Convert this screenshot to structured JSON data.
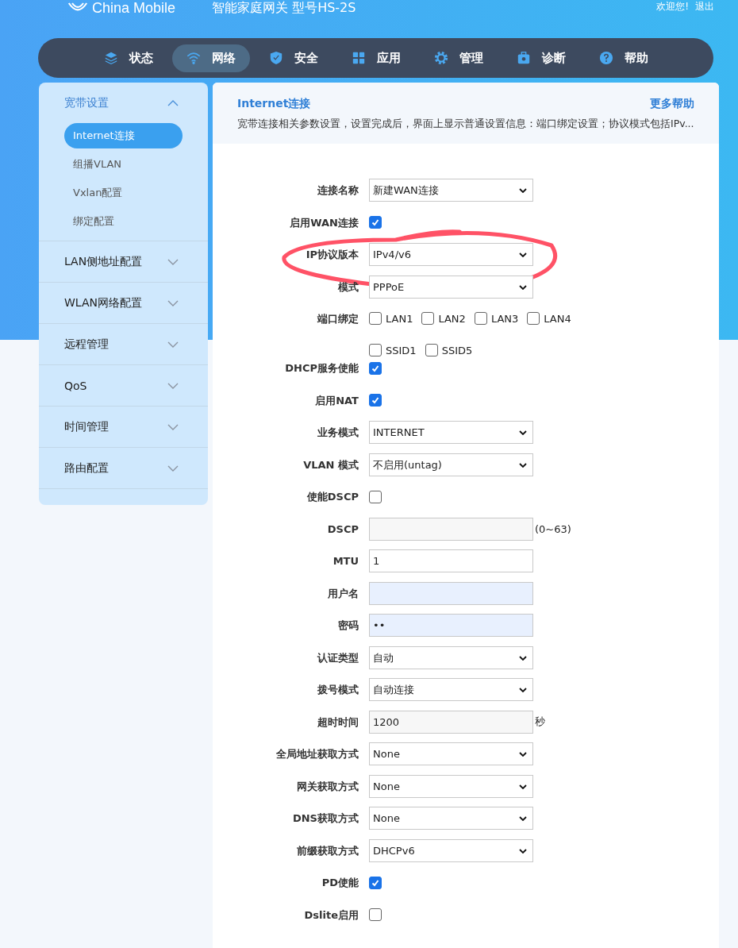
{
  "header": {
    "logo_text": "China Mobile",
    "title": "智能家庭网关 型号HS-2S",
    "welcome": "欢迎您!",
    "logout": "退出"
  },
  "nav": [
    {
      "label": "状态",
      "selected": false
    },
    {
      "label": "网络",
      "selected": true
    },
    {
      "label": "安全",
      "selected": false
    },
    {
      "label": "应用",
      "selected": false
    },
    {
      "label": "管理",
      "selected": false
    },
    {
      "label": "诊断",
      "selected": false
    },
    {
      "label": "帮助",
      "selected": false
    }
  ],
  "sidebar": {
    "items": [
      {
        "label": "宽带设置",
        "expanded": true,
        "children": [
          {
            "label": "Internet连接",
            "selected": true
          },
          {
            "label": "组播VLAN",
            "selected": false
          },
          {
            "label": "Vxlan配置",
            "selected": false
          },
          {
            "label": "绑定配置",
            "selected": false
          }
        ]
      },
      {
        "label": "LAN侧地址配置",
        "expanded": false
      },
      {
        "label": "WLAN网络配置",
        "expanded": false
      },
      {
        "label": "远程管理",
        "expanded": false
      },
      {
        "label": "QoS",
        "expanded": false
      },
      {
        "label": "时间管理",
        "expanded": false
      },
      {
        "label": "路由配置",
        "expanded": false
      }
    ]
  },
  "panel": {
    "title": "Internet连接",
    "help_link": "更多帮助",
    "description": "宽带连接相关参数设置，设置完成后，界面上显示普通设置信息：端口绑定设置；协议模式包括IPv..."
  },
  "form": [
    {
      "label": "连接名称",
      "kind": "select",
      "value": "新建WAN连接",
      "highlighted": false
    },
    {
      "label": "启用WAN连接",
      "kind": "checkbox",
      "checked": true,
      "highlighted": false
    },
    {
      "label": "IP协议版本",
      "kind": "select",
      "value": "IPv4/v6",
      "highlighted": true
    },
    {
      "label": "模式",
      "kind": "select",
      "value": "PPPoE",
      "highlighted": false
    },
    {
      "label": "端口绑定",
      "kind": "checkgroup",
      "highlighted": false,
      "options": [
        [
          {
            "label": "LAN1",
            "checked": false
          },
          {
            "label": "LAN2",
            "checked": false
          },
          {
            "label": "LAN3",
            "checked": false
          },
          {
            "label": "LAN4",
            "checked": false
          }
        ],
        [
          {
            "label": "SSID1",
            "checked": false
          },
          {
            "label": "SSID5",
            "checked": false
          }
        ]
      ]
    },
    {
      "label": "DHCP服务使能",
      "kind": "checkbox",
      "checked": true,
      "highlighted": false
    },
    {
      "label": "启用NAT",
      "kind": "checkbox",
      "checked": true,
      "highlighted": false
    },
    {
      "label": "业务模式",
      "kind": "select",
      "value": "INTERNET",
      "highlighted": false
    },
    {
      "label": "VLAN 模式",
      "kind": "select",
      "value": "不启用(untag)",
      "highlighted": false
    },
    {
      "label": "使能DSCP",
      "kind": "checkbox",
      "checked": false,
      "highlighted": false
    },
    {
      "label": "DSCP",
      "kind": "readonly-input",
      "suffix": "(0~63)",
      "highlighted": false
    },
    {
      "label": "MTU",
      "kind": "input",
      "value": "1",
      "highlighted": false
    },
    {
      "label": "用户名",
      "kind": "autofill-input",
      "highlighted": false
    },
    {
      "label": "密码",
      "kind": "autofill-input",
      "value": "••",
      "highlighted": false
    },
    {
      "label": "认证类型",
      "kind": "select",
      "value": "自动",
      "highlighted": false
    },
    {
      "label": "拨号模式",
      "kind": "select",
      "value": "自动连接",
      "highlighted": false
    },
    {
      "label": "超时时间",
      "kind": "readonly-input",
      "value": "1200",
      "suffix": "秒",
      "highlighted": false
    },
    {
      "label": "全局地址获取方式",
      "kind": "select",
      "value": "None",
      "highlighted": false
    },
    {
      "label": "网关获取方式",
      "kind": "select",
      "value": "None",
      "highlighted": false
    },
    {
      "label": "DNS获取方式",
      "kind": "select",
      "value": "None",
      "highlighted": false
    },
    {
      "label": "前缀获取方式",
      "kind": "select",
      "value": "DHCPv6",
      "highlighted": false
    },
    {
      "label": "PD使能",
      "kind": "checkbox",
      "checked": true,
      "highlighted": false
    },
    {
      "label": "Dslite启用",
      "kind": "checkbox",
      "checked": false,
      "highlighted": false
    }
  ]
}
